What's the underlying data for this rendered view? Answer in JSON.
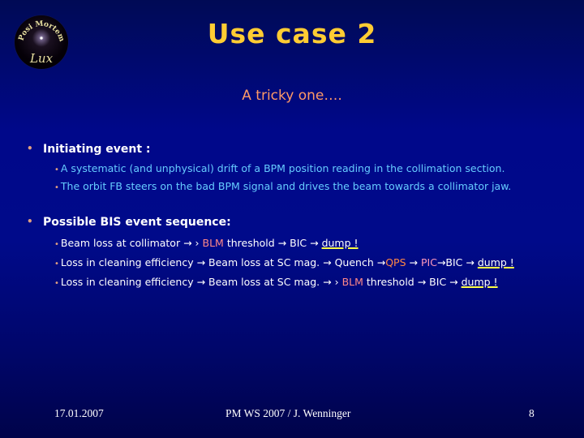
{
  "logo": {
    "icon": "posi-mortem-lux-logo",
    "top_text": "Posi Mortem",
    "bottom_text": "Lux"
  },
  "title": "Use case 2",
  "subtitle": "A tricky one….",
  "sections": [
    {
      "heading": "Initiating event :",
      "items": [
        {
          "text": "A systematic (and unphysical) drift of  a BPM position reading in the collimation section."
        },
        {
          "text": "The orbit FB steers on the bad BPM signal and drives the beam towards a collimator jaw."
        }
      ]
    },
    {
      "heading": "Possible BIS event sequence:",
      "items": [
        {
          "parts": [
            "Beam loss at collimator ",
            "→",
            " › ",
            "BLM",
            " threshold ",
            "→",
            " BIC ",
            "→",
            " ",
            "dump !"
          ]
        },
        {
          "parts": [
            "Loss in cleaning efficiency ",
            "→",
            " Beam loss at SC mag. ",
            "→",
            " Quench ",
            "→",
            "QPS",
            " ",
            "→",
            " ",
            "PIC",
            "→",
            "BIC ",
            "→",
            " ",
            "dump !"
          ]
        },
        {
          "parts": [
            "Loss in cleaning efficiency ",
            "→",
            " Beam loss at SC mag. ",
            "→",
            " › ",
            "BLM",
            " threshold ",
            "→",
            " BIC ",
            "→",
            " ",
            "dump !"
          ]
        }
      ]
    }
  ],
  "colors": {
    "title": "#ffcc33",
    "subtitle": "#ff9966",
    "sub_text_section1": "#66ccff",
    "sub_text_section2": "#ffffff",
    "blm": "#ff8888",
    "qps": "#ff8844",
    "pic": "#ff99bb",
    "dump_underline": "#ffff44"
  },
  "footer": {
    "date": "17.01.2007",
    "center": "PM WS 2007 / J. Wenninger",
    "page_number": "8"
  }
}
